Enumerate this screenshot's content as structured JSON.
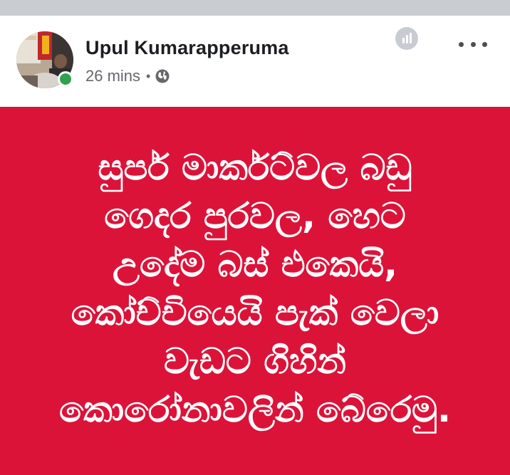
{
  "post": {
    "author": "Upul Kumarapperuma",
    "time": "26 mins",
    "separator": "•",
    "privacy_icon": "globe-icon",
    "insights_icon": "bar-chart-icon",
    "more_icon": "more-options-icon",
    "online": true,
    "background_color": "#dc1339",
    "text_color": "#ffffff",
    "lines": [
      "සුපර් මාර්කට්වල බඩු",
      "ගෙදර පුරවල, හෙට",
      "උදේම බස් එකෙයි,",
      "කෝච්චියෙයි පැක් වෙලා",
      "වැඩට ගිහින්",
      "කොරෝනාවලින් බේරෙමු."
    ]
  },
  "colors": {
    "online_indicator": "#31a24c",
    "name": "#1c1e21",
    "meta": "#65676b",
    "top_strip": "#c9ccd1"
  }
}
